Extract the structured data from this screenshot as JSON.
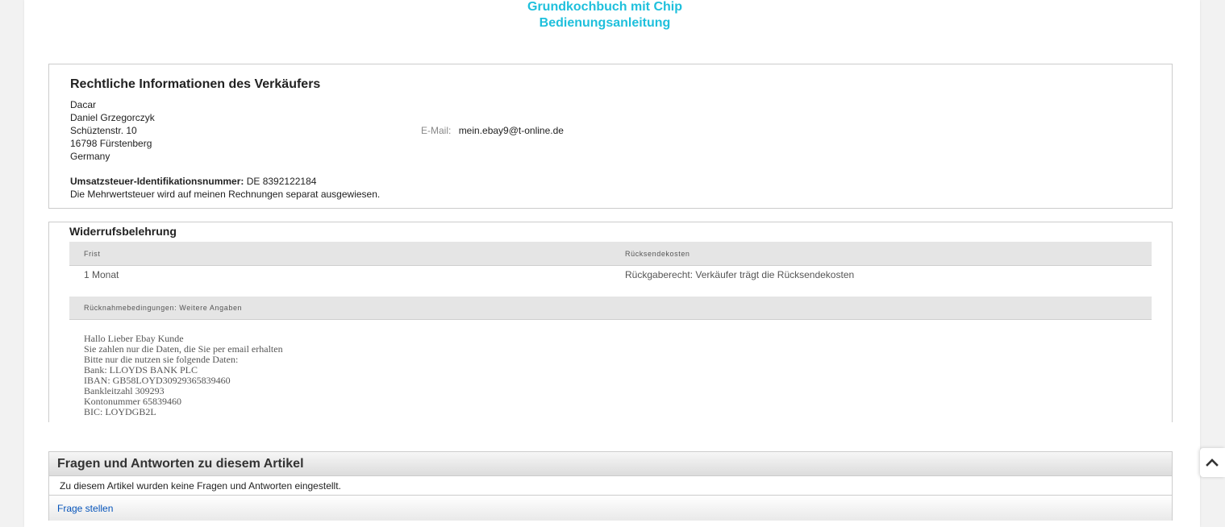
{
  "product": {
    "title_line1": "Grundkochbuch mit Chip",
    "title_line2": "Bedienungsanleitung"
  },
  "legal": {
    "title": "Rechtliche Informationen des Verkäufers",
    "address": [
      "Dacar",
      "Daniel Grzegorczyk",
      "Schüztenstr. 10",
      "16798 Fürstenberg",
      "Germany"
    ],
    "email_label": "E-Mail:",
    "email_value": "mein.ebay9@t-online.de",
    "vat_label": "Umsatzsteuer-Identifikationsnummer:",
    "vat_value": " DE 8392122184",
    "vat_note": "Die Mehrwertsteuer wird auf meinen Rechnungen separat ausgewiesen."
  },
  "withdrawal": {
    "title": "Widerrufsbelehrung",
    "col_deadline": "Frist",
    "col_return_costs": "Rücksendekosten",
    "deadline_value": "1 Monat",
    "return_costs_value": "Rückgaberecht: Verkäufer trägt die Rücksendekosten",
    "terms_header": "Rücknahmebedingungen: Weitere Angaben",
    "terms_lines": [
      "Hallo Lieber Ebay Kunde",
      "Sie zahlen nur die Daten, die Sie per email erhalten",
      "Bitte nur die nutzen sie folgende Daten:",
      "Bank: LLOYDS BANK PLC",
      "IBAN: GB58LOYD30929365839460",
      "Bankleitzahl 309293",
      "Kontonummer 65839460",
      "BIC: LOYDGB2L"
    ]
  },
  "qa": {
    "title": "Fragen und Antworten zu diesem Artikel",
    "empty_text": "Zu diesem Artikel wurden keine Fragen und Antworten eingestellt.",
    "ask_link": "Frage stellen"
  },
  "colors": {
    "title_cyan": "#1fc0dc",
    "link_blue": "#0654ba",
    "table_header_bg": "#e5e5e5"
  },
  "icons": {
    "scroll_top": "chevron-up-icon"
  }
}
